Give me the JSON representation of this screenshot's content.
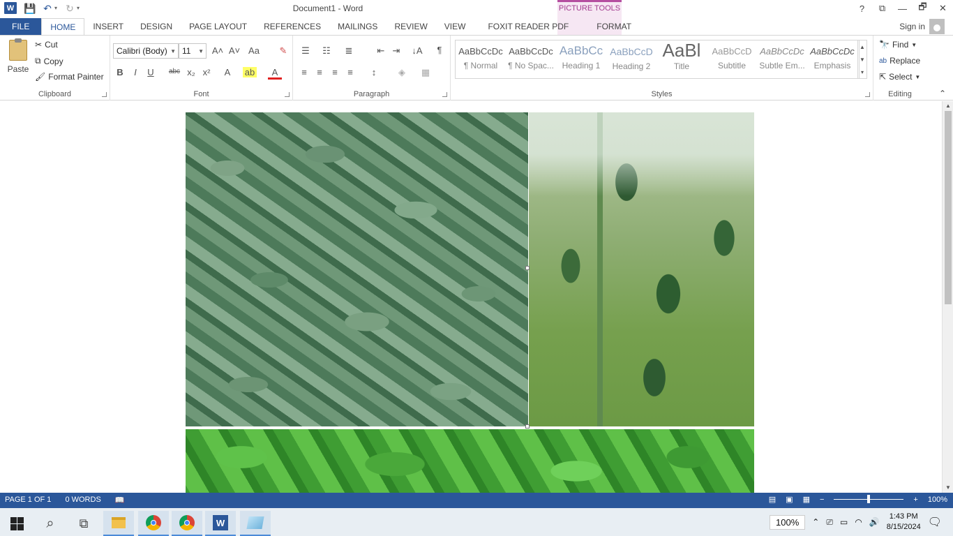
{
  "titlebar": {
    "app_logo": "W",
    "title": "Document1 - Word",
    "contextual_group": "PICTURE TOOLS",
    "help": "?",
    "controls": {
      "restore_ribbon": "⧉",
      "minimize": "—",
      "maximize": "🗗",
      "close": "✕"
    }
  },
  "qat": {
    "save_icon": "💾",
    "undo_icon": "↶",
    "redo_icon": "↻",
    "customize_caret": "▾"
  },
  "tabs": [
    {
      "label": "FILE"
    },
    {
      "label": "HOME"
    },
    {
      "label": "INSERT"
    },
    {
      "label": "DESIGN"
    },
    {
      "label": "PAGE LAYOUT"
    },
    {
      "label": "REFERENCES"
    },
    {
      "label": "MAILINGS"
    },
    {
      "label": "REVIEW"
    },
    {
      "label": "VIEW"
    },
    {
      "label": "FOXIT READER PDF"
    },
    {
      "label": "FORMAT"
    }
  ],
  "active_tab": "HOME",
  "account": {
    "signin": "Sign in"
  },
  "ribbon": {
    "clipboard": {
      "label": "Clipboard",
      "paste": "Paste",
      "cut": "Cut",
      "copy": "Copy",
      "format_painter": "Format Painter"
    },
    "font": {
      "label": "Font",
      "font_name": "Calibri (Body)",
      "font_size": "11",
      "grow": "A˄",
      "shrink": "A˅",
      "change_case": "Aa",
      "clear": "✎",
      "bold": "B",
      "italic": "I",
      "underline": "U",
      "strike": "abc",
      "subscript": "x₂",
      "superscript": "x²",
      "effects": "A",
      "highlight": "ab",
      "color": "A"
    },
    "paragraph": {
      "label": "Paragraph",
      "pilcrow": "¶",
      "sort": "↓A"
    },
    "styles": {
      "label": "Styles",
      "items": [
        {
          "sample": "AaBbCcDc",
          "name": "¶ Normal"
        },
        {
          "sample": "AaBbCcDc",
          "name": "¶ No Spac..."
        },
        {
          "sample": "AaBbCc",
          "name": "Heading 1"
        },
        {
          "sample": "AaBbCcD",
          "name": "Heading 2"
        },
        {
          "sample": "AaBl",
          "name": "Title"
        },
        {
          "sample": "AaBbCcD",
          "name": "Subtitle"
        },
        {
          "sample": "AaBbCcDc",
          "name": "Subtle Em..."
        },
        {
          "sample": "AaBbCcDc",
          "name": "Emphasis"
        }
      ]
    },
    "editing": {
      "label": "Editing",
      "find": "Find",
      "replace": "Replace",
      "select": "Select"
    }
  },
  "statusbar": {
    "page": "PAGE 1 OF 1",
    "words": "0 WORDS",
    "zoom": "100%"
  },
  "taskbar": {
    "zoom_badge": "100%",
    "time": "1:43 PM",
    "date": "8/15/2024"
  },
  "colors": {
    "word_blue": "#2b579a",
    "picture_tools": "#a33c8f"
  }
}
